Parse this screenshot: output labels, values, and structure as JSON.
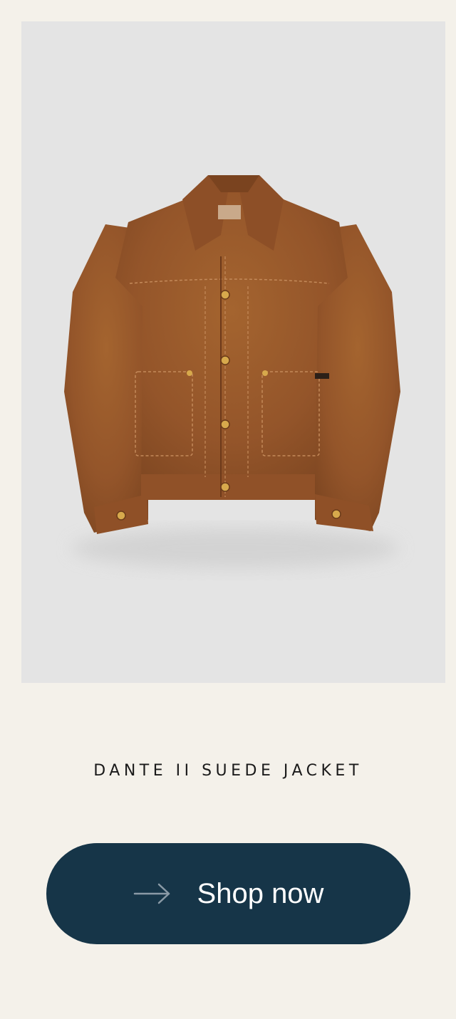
{
  "product": {
    "image_alt": "jacket-product-photo",
    "name": "DANTE II SUEDE JACKET"
  },
  "cta": {
    "label": "Shop now",
    "icon": "arrow-right-icon"
  },
  "colors": {
    "page_background": "#f4f1ea",
    "card_background": "#e4e4e4",
    "button_background": "#163548",
    "jacket": "#9a5a2c",
    "arrow": "#8a9aa6"
  }
}
